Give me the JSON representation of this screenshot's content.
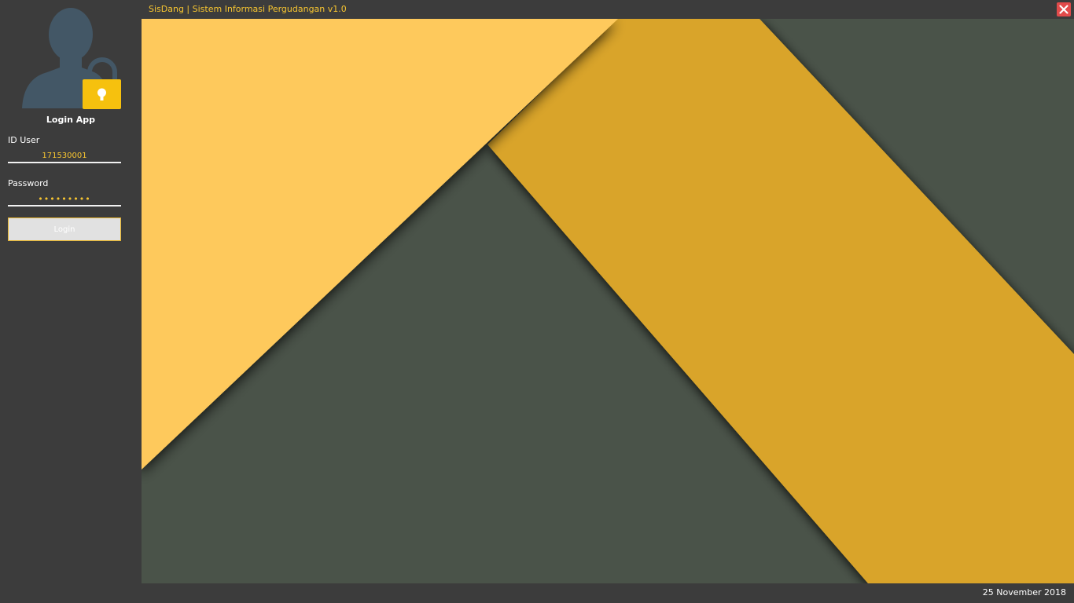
{
  "window": {
    "title": "SisDang | Sistem Informasi Pergudangan v1.0"
  },
  "login": {
    "heading": "Login App",
    "id_label": "ID User",
    "id_value": "171530001",
    "password_label": "Password",
    "password_value": "•••••••••",
    "button_label": "Login"
  },
  "status": {
    "date": "25 November 2018"
  },
  "icons": {
    "avatar": "user-lock-icon",
    "close": "close-icon"
  },
  "colors": {
    "accent": "#f7c531",
    "background": "#3c3c3c",
    "close": "#e24b4b"
  }
}
